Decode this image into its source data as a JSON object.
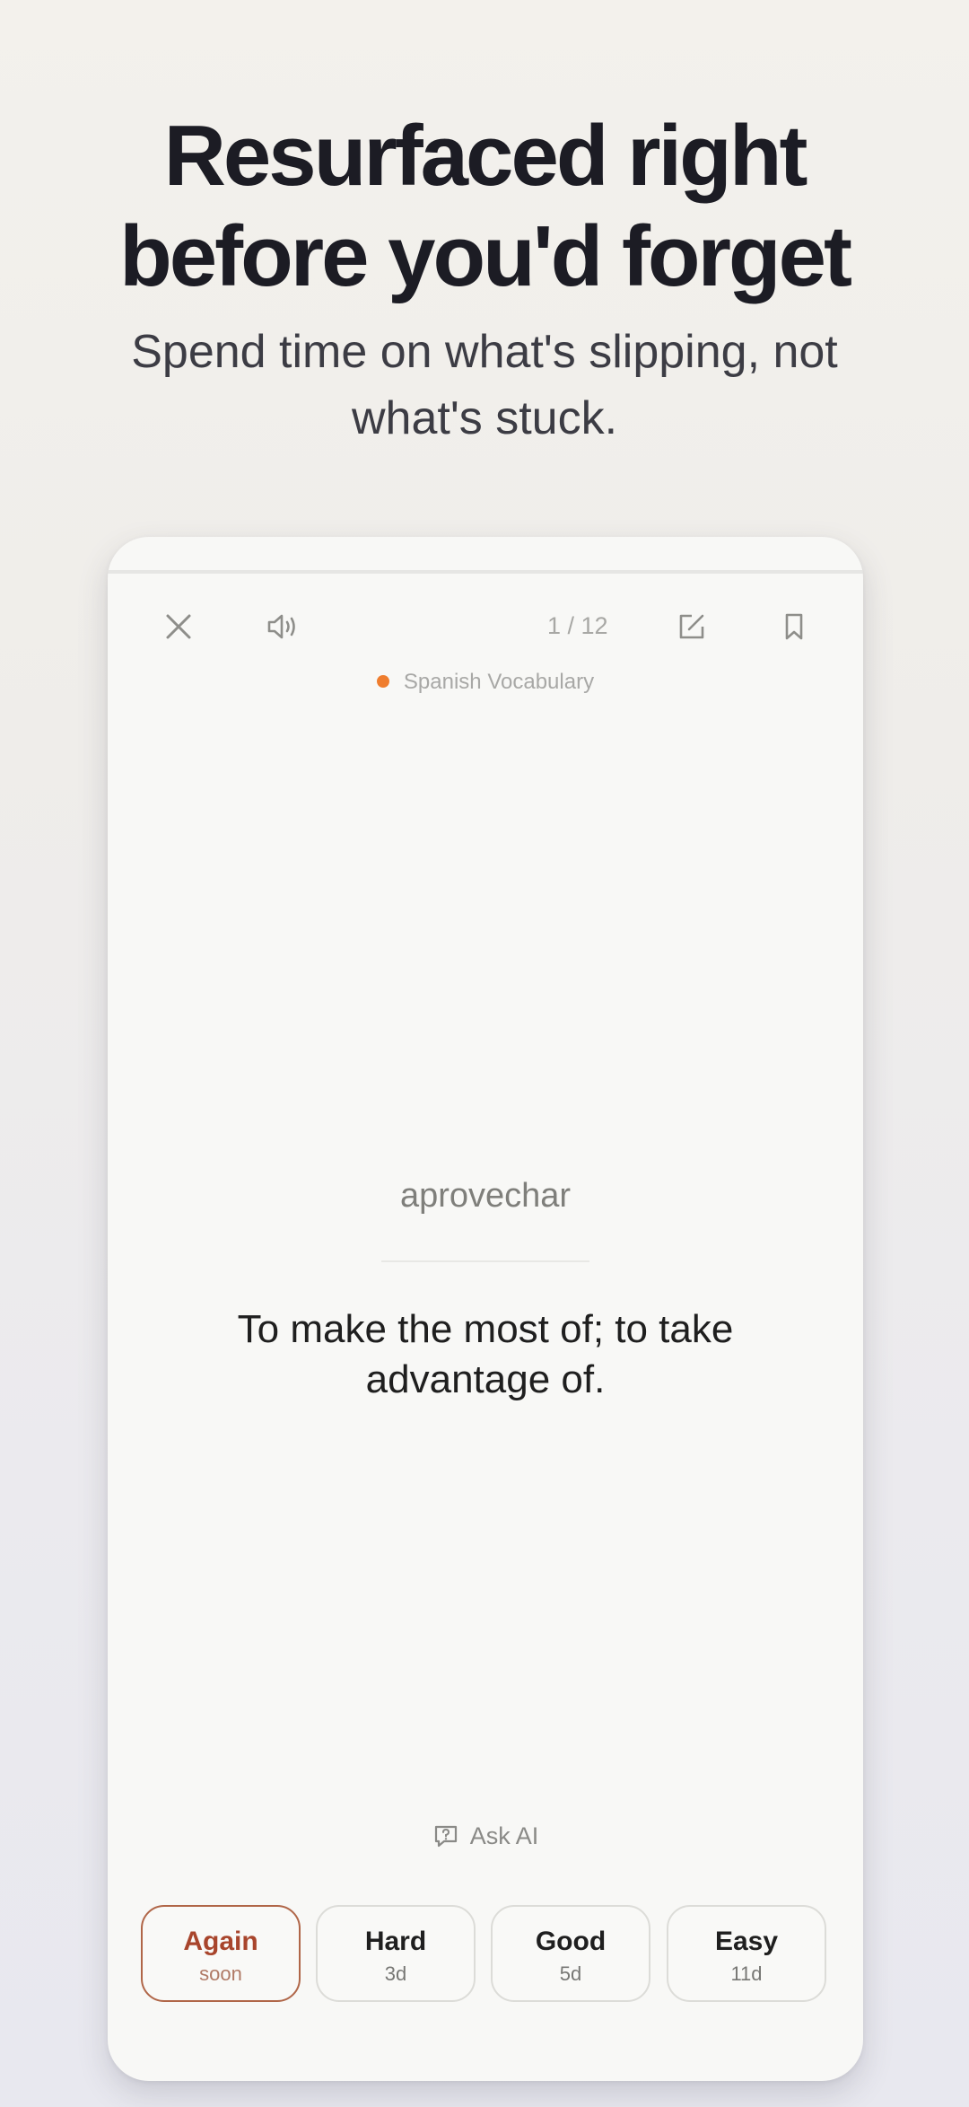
{
  "headline": {
    "line1": "Resurfaced right",
    "line2": "before you'd forget",
    "subtitle": "Spend time on what's slipping, not what's stuck."
  },
  "card": {
    "counter": "1 / 12",
    "deck_name": "Spanish Vocabulary",
    "deck_color": "#ef7d2e",
    "term": "aprovechar",
    "definition": "To make the most of; to take advantage of.",
    "ask_ai_label": "Ask AI",
    "icons": [
      "close-icon",
      "speaker-icon",
      "edit-icon",
      "bookmark-icon",
      "chat-question-icon"
    ],
    "buttons": [
      {
        "label": "Again",
        "interval": "soon"
      },
      {
        "label": "Hard",
        "interval": "3d"
      },
      {
        "label": "Good",
        "interval": "5d"
      },
      {
        "label": "Easy",
        "interval": "11d"
      }
    ]
  }
}
